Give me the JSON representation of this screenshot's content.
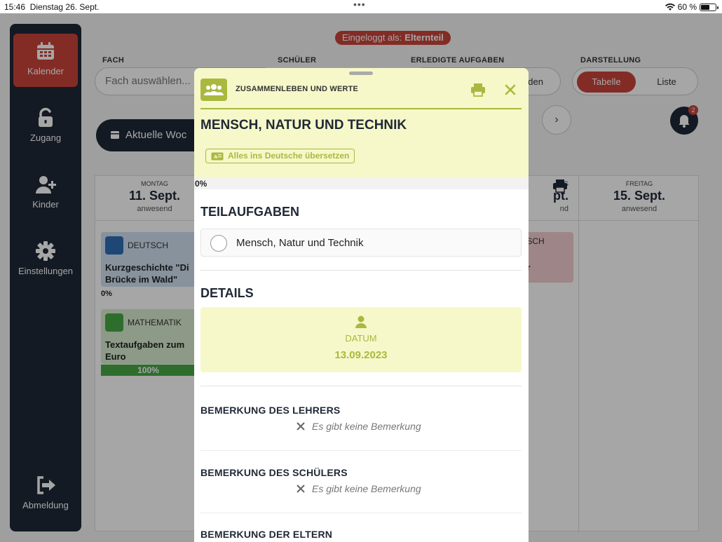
{
  "statusbar": {
    "time": "15:46",
    "date": "Dienstag 26. Sept.",
    "battery": "60 %",
    "battery_level": 0.6
  },
  "sidebar": {
    "items": [
      {
        "label": "Kalender",
        "icon": "calendar-icon",
        "active": true
      },
      {
        "label": "Zugang",
        "icon": "unlock-icon"
      },
      {
        "label": "Kinder",
        "icon": "add-user-icon"
      },
      {
        "label": "Einstellungen",
        "icon": "gear-icon"
      }
    ],
    "logout": {
      "label": "Abmeldung",
      "icon": "logout-icon"
    }
  },
  "header": {
    "login_prefix": "Eingeloggt als:",
    "login_role": "Elternteil"
  },
  "filters": {
    "fach_label": "FACH",
    "fach_placeholder": "Fach auswählen...",
    "schueler_label": "SCHÜLER",
    "erledigt_label": "ERLEDIGTE AUFGABEN",
    "erledigt_value_fragment": "den",
    "darstellung_label": "DARSTELLUNG",
    "opt_table": "Tabelle",
    "opt_list": "Liste"
  },
  "week_button": "Aktuelle Woc",
  "bell_badge": "2",
  "calendar": {
    "days": [
      {
        "name": "MONTAG",
        "date": "11. Sept.",
        "status": "anwesend"
      },
      {
        "name": "TAG",
        "date": "pt.",
        "status": "nd"
      },
      {
        "name": "FREITAG",
        "date": "15. Sept.",
        "status": "anwesend"
      }
    ],
    "cards": [
      {
        "subject": "DEUTSCH",
        "task_l1": "Kurzgeschichte \"Di",
        "task_l2": "Brücke im Wald\"",
        "progress": "0%"
      },
      {
        "subject": "MATHEMATIK",
        "task_l1": "Textaufgaben zum",
        "task_l2": "Euro",
        "progress": "100%"
      },
      {
        "subject": "SISCH",
        "task_l1": "-er"
      }
    ]
  },
  "modal": {
    "subject": "ZUSAMMENLEBEN UND WERTE",
    "title": "MENSCH, NATUR UND TECHNIK",
    "translate": "Alles ins Deutsche übersetzen",
    "progress": "0%",
    "subtasks_heading": "TEILAUFGABEN",
    "subtasks": [
      {
        "label": "Mensch, Natur und Technik"
      }
    ],
    "details_heading": "DETAILS",
    "date_label": "DATUM",
    "date_value": "13.09.2023",
    "remarks": [
      {
        "heading": "BEMERKUNG DES LEHRERS",
        "value": "Es gibt keine Bemerkung"
      },
      {
        "heading": "BEMERKUNG DES SCHÜLERS",
        "value": "Es gibt keine Bemerkung"
      },
      {
        "heading": "BEMERKUNG DER ELTERN"
      }
    ]
  },
  "colors": {
    "accent": "#c9443a",
    "navy": "#1f2836",
    "subject_olive": "#a9b940",
    "modal_header_bg": "#f6f8c9"
  }
}
